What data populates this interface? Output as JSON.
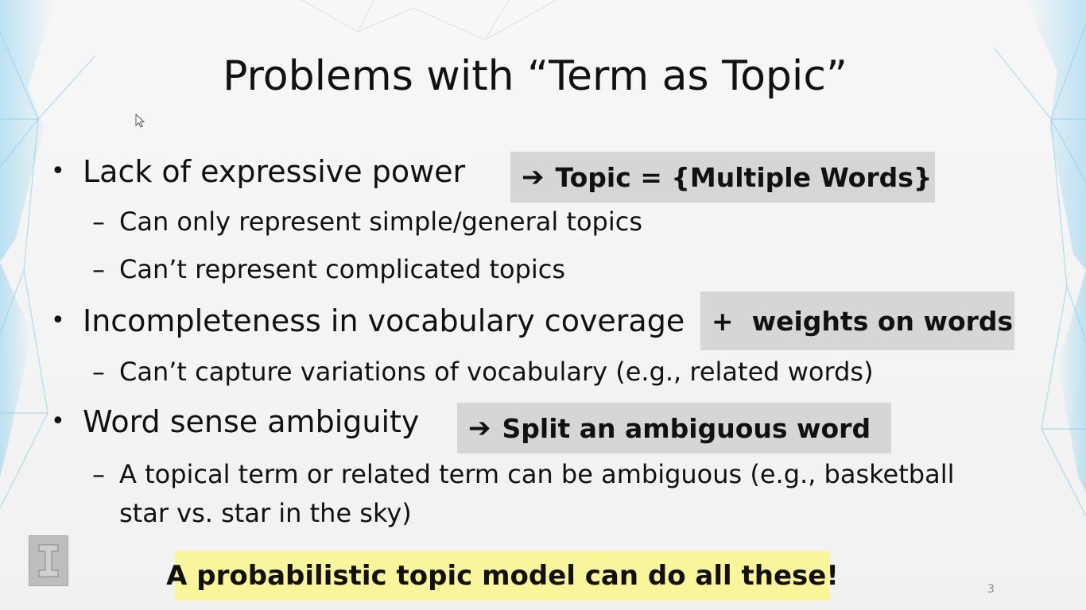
{
  "slide": {
    "title": "Problems with “Term as Topic”",
    "page_number": "3",
    "bullets": [
      {
        "text": "Lack of expressive power",
        "callout": "Topic = {Multiple Words}",
        "callout_icon": "arrow-right-icon",
        "sub_bullets": [
          "Can only represent simple/general topics",
          "Can’t represent complicated topics"
        ]
      },
      {
        "text": "Incompleteness in vocabulary coverage",
        "callout": "+  weights on words",
        "sub_bullets": [
          "Can’t capture variations of vocabulary (e.g., related words)"
        ]
      },
      {
        "text": "Word sense ambiguity",
        "callout": "Split an ambiguous word",
        "callout_icon": "arrow-right-icon",
        "sub_bullets": [
          "A topical term or related term can be ambiguous (e.g., basketball",
          "star vs. star in the sky)"
        ]
      }
    ],
    "conclusion": "A probabilistic topic model can do all these!",
    "colors": {
      "callout_background": "#d6d6d6",
      "conclusion_background": "#f9f59a",
      "accent_lines": "#8ed1ee"
    }
  }
}
